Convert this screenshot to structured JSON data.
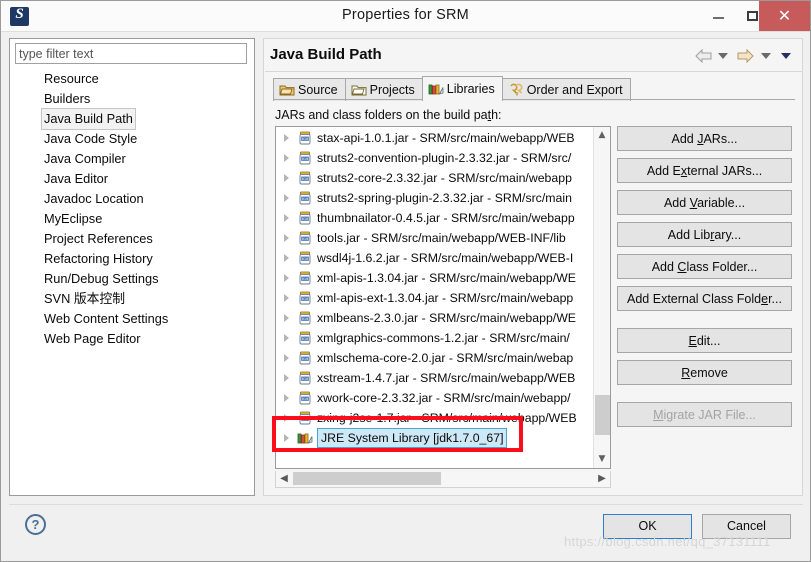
{
  "window": {
    "title": "Properties for SRM",
    "app_icon": "myeclipse-icon",
    "minimize_label": "–",
    "maximize_label": "□",
    "close_label": "✕"
  },
  "sidebar": {
    "filter": {
      "placeholder": "type filter text",
      "value": ""
    },
    "items": [
      {
        "label": "Resource",
        "selected": false
      },
      {
        "label": "Builders",
        "selected": false
      },
      {
        "label": "Java Build Path",
        "selected": true
      },
      {
        "label": "Java Code Style",
        "selected": false
      },
      {
        "label": "Java Compiler",
        "selected": false
      },
      {
        "label": "Java Editor",
        "selected": false
      },
      {
        "label": "Javadoc Location",
        "selected": false
      },
      {
        "label": "MyEclipse",
        "selected": false
      },
      {
        "label": "Project References",
        "selected": false
      },
      {
        "label": "Refactoring History",
        "selected": false
      },
      {
        "label": "Run/Debug Settings",
        "selected": false
      },
      {
        "label": "SVN 版本控制",
        "selected": false
      },
      {
        "label": "Web Content Settings",
        "selected": false
      },
      {
        "label": "Web Page Editor",
        "selected": false
      }
    ]
  },
  "page": {
    "title": "Java Build Path",
    "nav": {
      "back_icon": "back-arrow-icon",
      "back_menu_icon": "chevron-down-icon",
      "forward_icon": "forward-arrow-icon",
      "forward_menu_icon": "chevron-down-icon",
      "view_menu_icon": "chevron-down-icon"
    }
  },
  "tabs": [
    {
      "label": "Source",
      "icon": "source-folder-icon",
      "active": false
    },
    {
      "label": "Projects",
      "icon": "projects-folder-icon",
      "active": false
    },
    {
      "label": "Libraries",
      "icon": "libraries-books-icon",
      "active": true
    },
    {
      "label": "Order and Export",
      "icon": "order-export-icon",
      "active": false
    }
  ],
  "libraries": {
    "list_label_pre": "JARs and class folders on the build pa",
    "list_label_underlined": "t",
    "list_label_post": "h:",
    "entries": [
      {
        "text": "stax-api-1.0.1.jar - SRM/src/main/webapp/WEB",
        "icon": "jar-icon",
        "selected": false
      },
      {
        "text": "struts2-convention-plugin-2.3.32.jar - SRM/src/",
        "icon": "jar-icon",
        "selected": false
      },
      {
        "text": "struts2-core-2.3.32.jar - SRM/src/main/webapp",
        "icon": "jar-icon",
        "selected": false
      },
      {
        "text": "struts2-spring-plugin-2.3.32.jar - SRM/src/main",
        "icon": "jar-icon",
        "selected": false
      },
      {
        "text": "thumbnailator-0.4.5.jar - SRM/src/main/webapp",
        "icon": "jar-icon",
        "selected": false
      },
      {
        "text": "tools.jar - SRM/src/main/webapp/WEB-INF/lib",
        "icon": "jar-icon",
        "selected": false
      },
      {
        "text": "wsdl4j-1.6.2.jar - SRM/src/main/webapp/WEB-I",
        "icon": "jar-icon",
        "selected": false
      },
      {
        "text": "xml-apis-1.3.04.jar - SRM/src/main/webapp/WE",
        "icon": "jar-icon",
        "selected": false
      },
      {
        "text": "xml-apis-ext-1.3.04.jar - SRM/src/main/webapp",
        "icon": "jar-icon",
        "selected": false
      },
      {
        "text": "xmlbeans-2.3.0.jar - SRM/src/main/webapp/WE",
        "icon": "jar-icon",
        "selected": false
      },
      {
        "text": "xmlgraphics-commons-1.2.jar - SRM/src/main/ ",
        "icon": "jar-icon",
        "selected": false
      },
      {
        "text": "xmlschema-core-2.0.jar - SRM/src/main/webap",
        "icon": "jar-icon",
        "selected": false
      },
      {
        "text": "xstream-1.4.7.jar - SRM/src/main/webapp/WEB",
        "icon": "jar-icon",
        "selected": false
      },
      {
        "text": "xwork-core-2.3.32.jar - SRM/src/main/webapp/",
        "icon": "jar-icon",
        "selected": false
      },
      {
        "text": "zxing-j2se-1.7.jar - SRM/src/main/webapp/WEB",
        "icon": "jar-icon",
        "selected": false
      },
      {
        "text": "JRE System Library [jdk1.7.0_67]",
        "icon": "library-books-icon",
        "selected": true
      }
    ],
    "scrollbars": {
      "v_up_icon": "chevron-up-icon",
      "v_down_icon": "chevron-down-icon",
      "h_left_icon": "chevron-left-icon",
      "h_right_icon": "chevron-right-icon"
    },
    "buttons": [
      {
        "pre": "Add ",
        "key": "J",
        "post": "ARs...",
        "disabled": false,
        "gap": false
      },
      {
        "pre": "Add E",
        "key": "x",
        "post": "ternal JARs...",
        "disabled": false,
        "gap": false
      },
      {
        "pre": "Add ",
        "key": "V",
        "post": "ariable...",
        "disabled": false,
        "gap": false
      },
      {
        "pre": "Add Lib",
        "key": "r",
        "post": "ary...",
        "disabled": false,
        "gap": false
      },
      {
        "pre": "Add ",
        "key": "C",
        "post": "lass Folder...",
        "disabled": false,
        "gap": false
      },
      {
        "pre": "Add External Class Fold",
        "key": "e",
        "post": "r...",
        "disabled": false,
        "gap": false
      },
      {
        "pre": "",
        "key": "E",
        "post": "dit...",
        "disabled": false,
        "gap": true
      },
      {
        "pre": "",
        "key": "R",
        "post": "emove",
        "disabled": false,
        "gap": false
      },
      {
        "pre": "",
        "key": "M",
        "post": "igrate JAR File...",
        "disabled": true,
        "gap": true
      }
    ]
  },
  "footer": {
    "help_icon": "help-question-icon",
    "help_label": "?",
    "ok_label": "OK",
    "cancel_label": "Cancel"
  },
  "watermark": {
    "text": "https://blog.csdn.net/qq_37131111"
  },
  "annotation": {
    "highlight_color": "#fc0d1b"
  }
}
